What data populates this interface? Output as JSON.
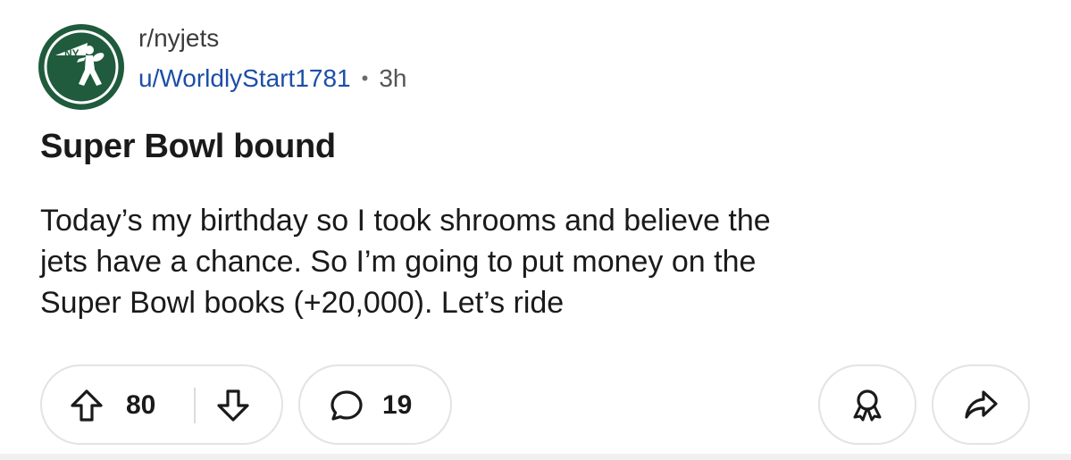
{
  "post": {
    "subreddit": "r/nyjets",
    "username": "u/WorldlyStart1781",
    "separator": "•",
    "timestamp": "3h",
    "title": "Super Bowl bound",
    "body_lines": [
      "Today’s my birthday so I took shrooms and believe the",
      "jets have a chance. So I’m going to put money on the",
      "Super Bowl books (+20,000). Let’s ride"
    ]
  },
  "actions": {
    "vote_count": "80",
    "comment_count": "19"
  },
  "icons": {
    "avatar": "nyjets-logo-icon",
    "upvote": "arrow-up-icon",
    "downvote": "arrow-down-icon",
    "comment": "speech-bubble-icon",
    "award": "award-ribbon-icon",
    "share": "share-arrow-icon"
  },
  "colors": {
    "jets_green": "#1f5b3c",
    "username_blue": "#1d4ea8",
    "border_gray": "#e3e3e3"
  }
}
